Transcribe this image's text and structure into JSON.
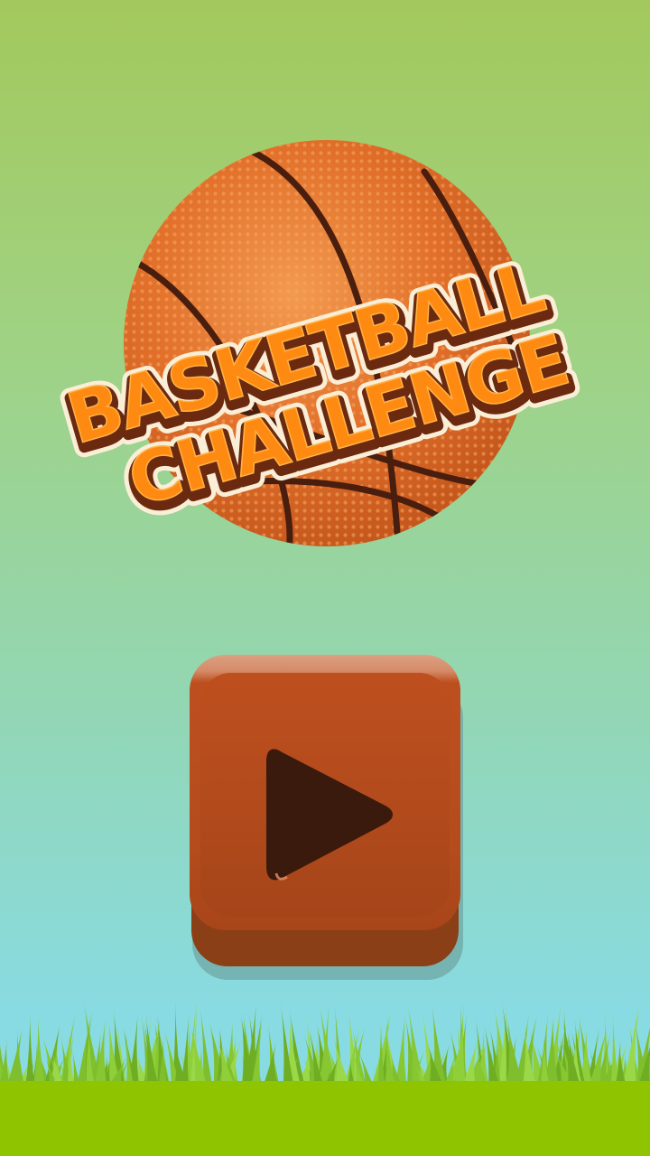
{
  "game": {
    "title_line1": "BASKETBALL",
    "title_line2": "CHALLENGE"
  },
  "play_button": {
    "icon": "play-icon"
  },
  "colors": {
    "sky_top": "#a3c95d",
    "sky_bottom": "#88dbe3",
    "ball": "#e2702a",
    "title_fill": "#ff8a12",
    "title_outline": "#6b2a0f",
    "button": "#b44c1d",
    "play_triangle": "#3a1a0c",
    "grass": "#8fc400"
  }
}
